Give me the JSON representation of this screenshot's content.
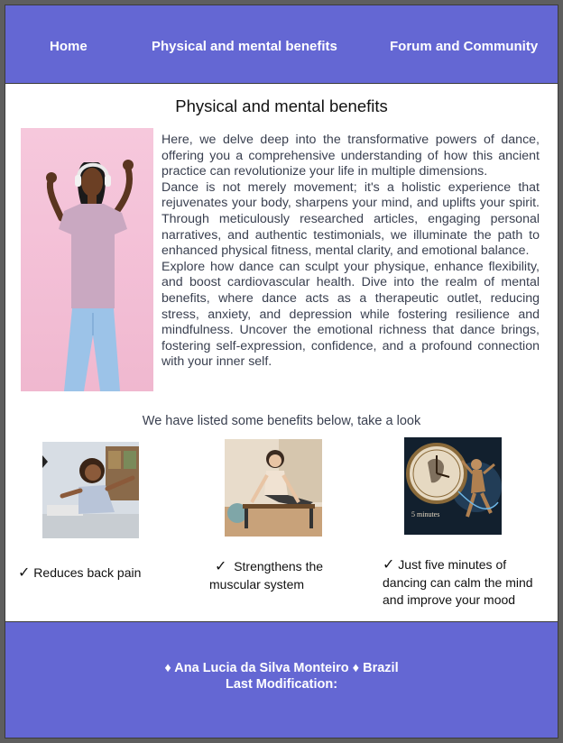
{
  "nav": {
    "home": "Home",
    "benefits": "Physical and mental benefits",
    "forum": "Forum and Community"
  },
  "main": {
    "title": "Physical and mental benefits",
    "paragraphs": [
      "Here, we delve deep into the transformative powers of dance, offering you a comprehensive understanding of how this ancient practice can revolutionize your life in multiple dimensions.",
      "Dance is not merely movement; it's a holistic experience that rejuvenates your body, sharpens your mind, and uplifts your spirit. Through meticulously researched articles, engaging personal narratives, and authentic testimonials, we illuminate the path to enhanced physical fitness, mental clarity, and emotional balance.",
      "Explore how dance can sculpt your physique, enhance flexibility, and boost cardiovascular health. Dive into the realm of mental benefits, where dance acts as a therapeutic outlet, reducing stress, anxiety, and depression while fostering resilience and mindfulness. Uncover the emotional richness that dance brings, fostering self-expression, confidence, and a profound connection with your inner self."
    ],
    "listed_intro": "We have listed some benefits below, take a look",
    "clock_caption": "5 minutes"
  },
  "benefits": [
    {
      "check": "✓",
      "text": "Reduces back pain"
    },
    {
      "check": "✓",
      "line1": "Strengthens the",
      "line2": "muscular system"
    },
    {
      "check": "✓",
      "line1": "Just five minutes of",
      "line2": "dancing can calm the mind",
      "line3": "and improve your mood"
    }
  ],
  "footer": {
    "author": "♦ Ana Lucia da Silva Monteiro ♦ Brazil",
    "modified": "Last Modification:"
  },
  "colors": {
    "header_bg": "#6467d3",
    "footer_bg": "#6467d3",
    "body_text": "#3a4050"
  }
}
